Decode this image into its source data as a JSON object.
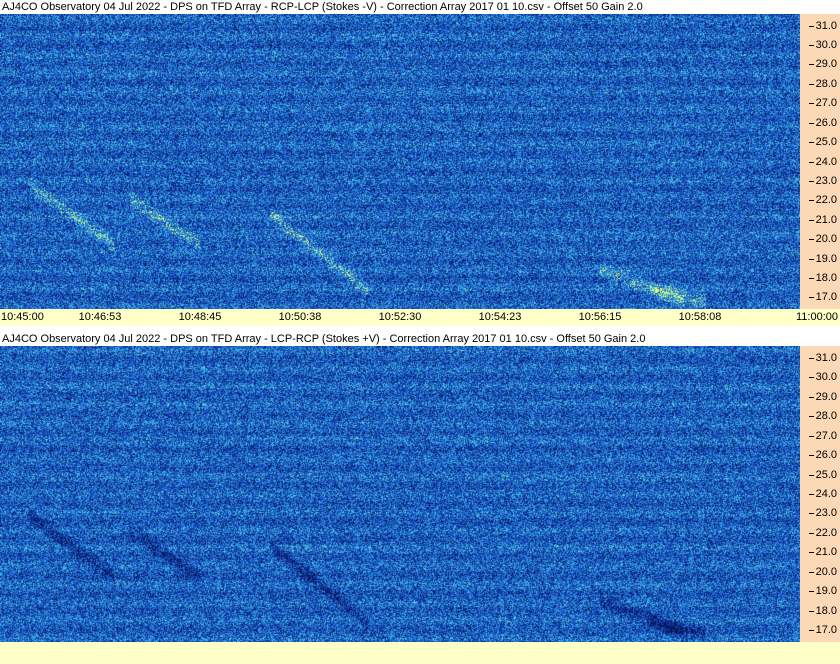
{
  "panels": [
    {
      "title": "AJ4CO Observatory 04 Jul 2022  -  DPS on TFD Array  -  RCP-LCP (Stokes -V)  -  Correction Array 2017 01 10.csv  -  Offset 50  Gain 2.0",
      "polarity": "bright"
    },
    {
      "title": "AJ4CO Observatory 04 Jul 2022  -  DPS on TFD Array  -  LCP-RCP (Stokes +V)  -  Correction Array 2017 01 10.csv  -  Offset 50  Gain 2.0",
      "polarity": "dark"
    }
  ],
  "x_axis_labels": [
    "10:45:00",
    "10:46:53",
    "10:48:45",
    "10:50:38",
    "10:52:30",
    "10:54:23",
    "10:56:15",
    "10:58:08",
    "11:00:00"
  ],
  "colors": {
    "background_low": "#0a1f6e",
    "background_mid": "#1f5fbf",
    "highlight": "#e8ff70",
    "axis_panel": "#fbd9b6",
    "time_bar": "#ffffc8"
  },
  "chart_data": [
    {
      "type": "heatmap",
      "title": "AJ4CO Observatory 04 Jul 2022  -  DPS on TFD Array  -  RCP-LCP (Stokes -V)  -  Correction Array 2017 01 10.csv  -  Offset 50  Gain 2.0",
      "xlim": [
        "10:45:00",
        "11:00:00"
      ],
      "ylim": [
        16.4,
        31.6
      ],
      "x_ticks": [
        "10:45:00",
        "10:46:53",
        "10:48:45",
        "10:50:38",
        "10:52:30",
        "10:54:23",
        "10:56:15",
        "10:58:08",
        "11:00:00"
      ],
      "y_ticks": [
        "31.0",
        "30.0",
        "29.0",
        "28.0",
        "27.0",
        "26.0",
        "25.0",
        "24.0",
        "23.0",
        "22.0",
        "21.0",
        "20.0",
        "19.0",
        "18.0",
        "17.0"
      ]
    },
    {
      "type": "heatmap",
      "title": "AJ4CO Observatory 04 Jul 2022  -  DPS on TFD Array  -  LCP-RCP (Stokes +V)  -  Correction Array 2017 01 10.csv  -  Offset 50  Gain 2.0",
      "xlim": [
        "10:45:00",
        "11:00:00"
      ],
      "ylim": [
        16.4,
        31.6
      ],
      "y_ticks": [
        "31.0",
        "30.0",
        "29.0",
        "28.0",
        "27.0",
        "26.0",
        "25.0",
        "24.0",
        "23.0",
        "22.0",
        "21.0",
        "20.0",
        "19.0",
        "18.0",
        "17.0"
      ]
    }
  ]
}
